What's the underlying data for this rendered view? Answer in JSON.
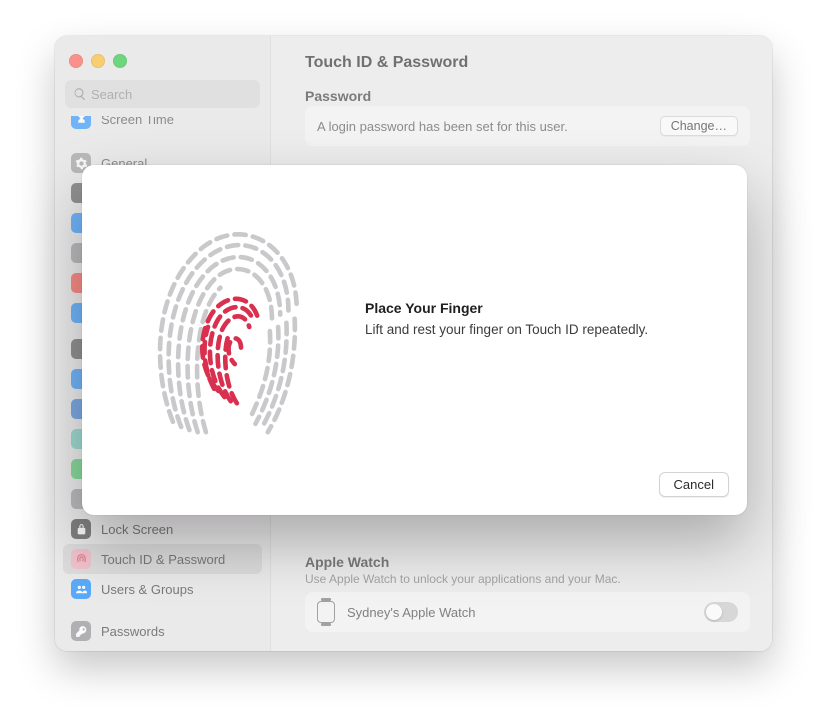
{
  "header": {
    "title": "Touch ID & Password"
  },
  "search": {
    "placeholder": "Search"
  },
  "sidebar": {
    "items": [
      {
        "label": "Screen Time"
      },
      {
        "label": "General"
      },
      {
        "label": ""
      },
      {
        "label": ""
      },
      {
        "label": ""
      },
      {
        "label": ""
      },
      {
        "label": ""
      },
      {
        "label": ""
      },
      {
        "label": ""
      },
      {
        "label": ""
      },
      {
        "label": ""
      },
      {
        "label": ""
      },
      {
        "label": ""
      },
      {
        "label": "Lock Screen"
      },
      {
        "label": "Touch ID & Password"
      },
      {
        "label": "Users & Groups"
      },
      {
        "label": "Passwords"
      }
    ]
  },
  "password_section": {
    "title": "Password",
    "desc": "A login password has been set for this user.",
    "change_label": "Change…"
  },
  "watch_section": {
    "title": "Apple Watch",
    "sub": "Use Apple Watch to unlock your applications and your Mac.",
    "device": "Sydney's Apple Watch",
    "toggle_on": false
  },
  "sheet": {
    "title": "Place Your Finger",
    "desc": "Lift and rest your finger on Touch ID repeatedly.",
    "cancel_label": "Cancel"
  },
  "colors": {
    "fp_accent": "#d9304f",
    "fp_grey": "#c9c9cb"
  }
}
